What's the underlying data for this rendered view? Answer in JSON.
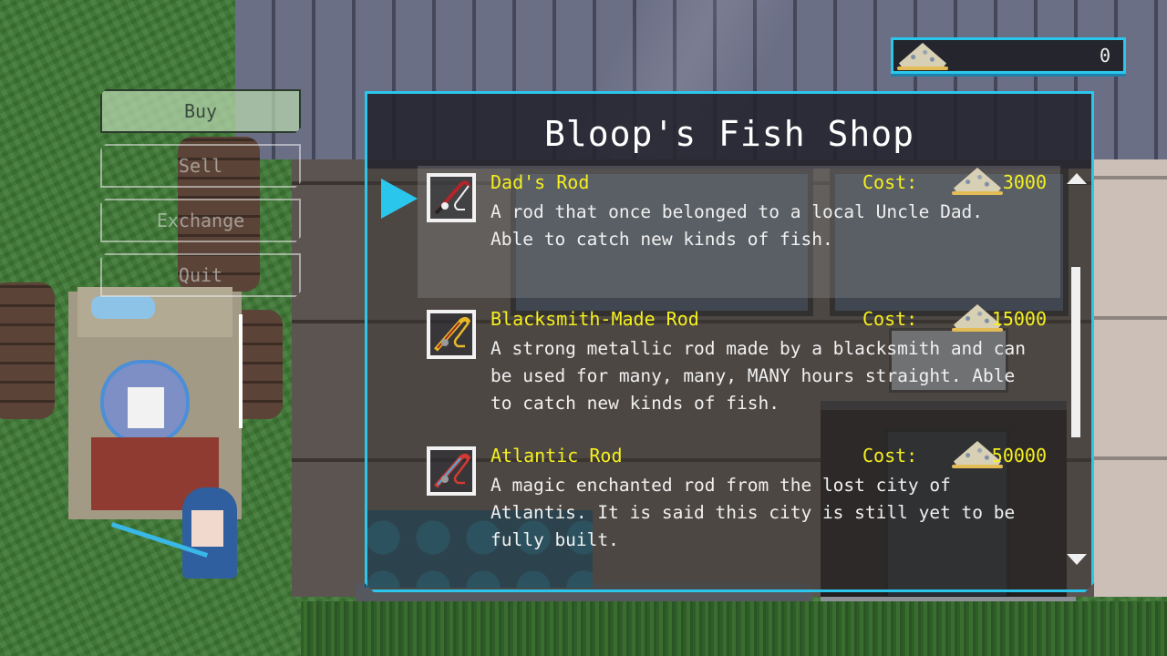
{
  "currency": {
    "icon": "sand-pile-icon",
    "value": "0"
  },
  "menu": {
    "items": [
      {
        "label": "Buy",
        "active": true
      },
      {
        "label": "Sell",
        "active": false
      },
      {
        "label": "Exchange",
        "active": false
      },
      {
        "label": "Quit",
        "active": false
      }
    ]
  },
  "shop": {
    "title": "Bloop's Fish Shop",
    "cost_label": "Cost:",
    "selected_index": 0,
    "items": [
      {
        "name": "Dad's Rod",
        "cost": "3000",
        "icon": "dads-rod-icon",
        "description": "A rod that once belonged to a local Uncle Dad.\nAble to catch new kinds of fish."
      },
      {
        "name": "Blacksmith-Made Rod",
        "cost": "15000",
        "icon": "blacksmith-rod-icon",
        "description": "A strong metallic rod made by a blacksmith and can\nbe used for many, many, MANY hours straight. Able\nto catch new kinds of fish."
      },
      {
        "name": "Atlantic Rod",
        "cost": "50000",
        "icon": "atlantic-rod-icon",
        "description": "A magic enchanted rod from the lost city of\nAtlantis. It is said this city is still yet to be\nfully built."
      }
    ],
    "scroll": {
      "thumb_start": 0.2,
      "thumb_end": 0.68
    }
  },
  "colors": {
    "accent": "#2bc6ec",
    "item_name": "#f5f01e",
    "text": "#f0f0f0"
  }
}
